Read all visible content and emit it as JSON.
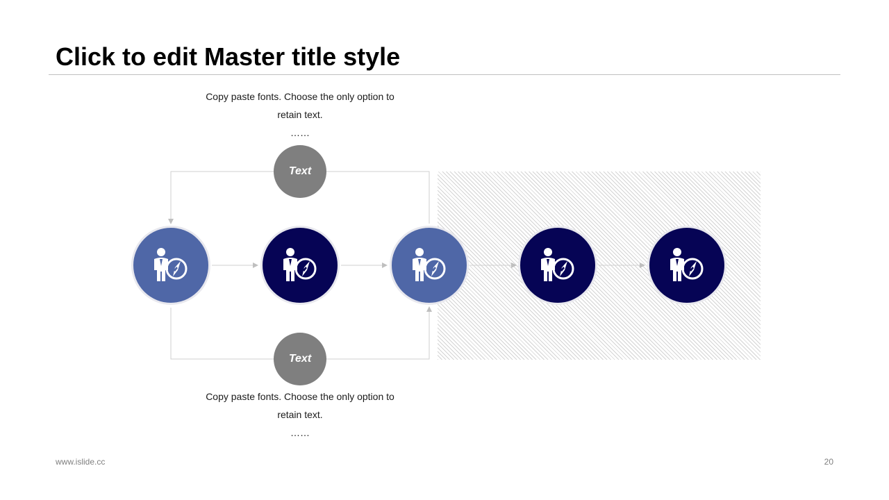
{
  "slide": {
    "title": "Click to edit Master title style",
    "footer_url": "www.islide.cc",
    "page_number": "20"
  },
  "top_label": {
    "line1": "Copy paste fonts. Choose the only option to",
    "line2": "retain text.",
    "dots": "……",
    "node_text": "Text"
  },
  "bottom_label": {
    "line1": "Copy paste fonts. Choose the only option to",
    "line2": "retain text.",
    "dots": "……",
    "node_text": "Text"
  },
  "nodes": [
    {
      "icon": "businessman-compass-icon",
      "color": "#4f67a7"
    },
    {
      "icon": "businessman-compass-icon",
      "color": "#060455"
    },
    {
      "icon": "businessman-compass-icon",
      "color": "#4f67a7"
    },
    {
      "icon": "businessman-compass-icon",
      "color": "#060455"
    },
    {
      "icon": "businessman-compass-icon",
      "color": "#060455"
    }
  ],
  "colors": {
    "light_node": "#4f67a7",
    "dark_node": "#060455",
    "text_node": "#7f7f7f",
    "connector": "#bfbfbf"
  }
}
